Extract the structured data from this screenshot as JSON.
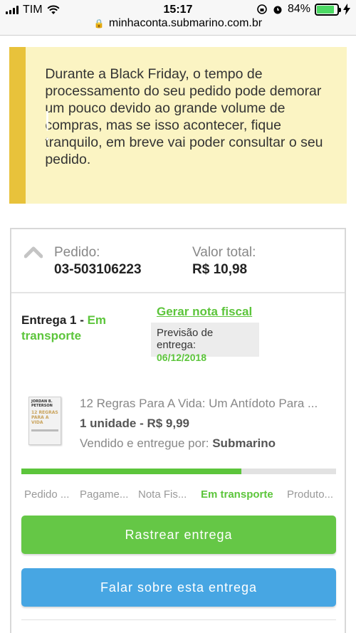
{
  "status_bar": {
    "carrier": "TIM",
    "time": "15:17",
    "battery": "84%",
    "battery_level": 0.84
  },
  "url_bar": {
    "url": "minhaconta.submarino.com.br"
  },
  "alert": {
    "icon": "!",
    "message": "Durante a Black Friday, o tempo de processamento do seu pedido pode demorar um pouco devido ao grande volume de compras, mas se isso acontecer, fique tranquilo, em breve vai poder consultar o seu pedido.",
    "colors": {
      "accent": "#e8c23b",
      "background": "#fbf4c3"
    }
  },
  "order": {
    "order_label": "Pedido:",
    "order_number": "03-503106223",
    "total_label": "Valor total:",
    "total_value": "R$ 10,98"
  },
  "delivery": {
    "title": "Entrega 1 -",
    "status": "Em transporte",
    "invoice_link": "Gerar nota fiscal",
    "forecast_label": "Previsão de entrega:",
    "forecast_date": "06/12/2018"
  },
  "product": {
    "cover_line1": "JORDAN B. PETERSON",
    "cover_line2": "12 REGRAS PARA A VIDA",
    "name": "12 Regras Para A Vida: Um Antídoto Para ...",
    "quantity_price": "1 unidade - R$ 9,99",
    "seller_label": "Vendido e entregue por:",
    "seller": "Submarino"
  },
  "tracking": {
    "progress": 0.7,
    "steps": [
      "Pedido ...",
      "Pagame...",
      "Nota Fis...",
      "Em transporte",
      "Produto..."
    ],
    "active_step": 3
  },
  "buttons": {
    "track": "Rastrear entrega",
    "talk": "Falar sobre esta entrega"
  },
  "colors": {
    "green": "#5cc53b",
    "blue": "#47a6e3"
  }
}
